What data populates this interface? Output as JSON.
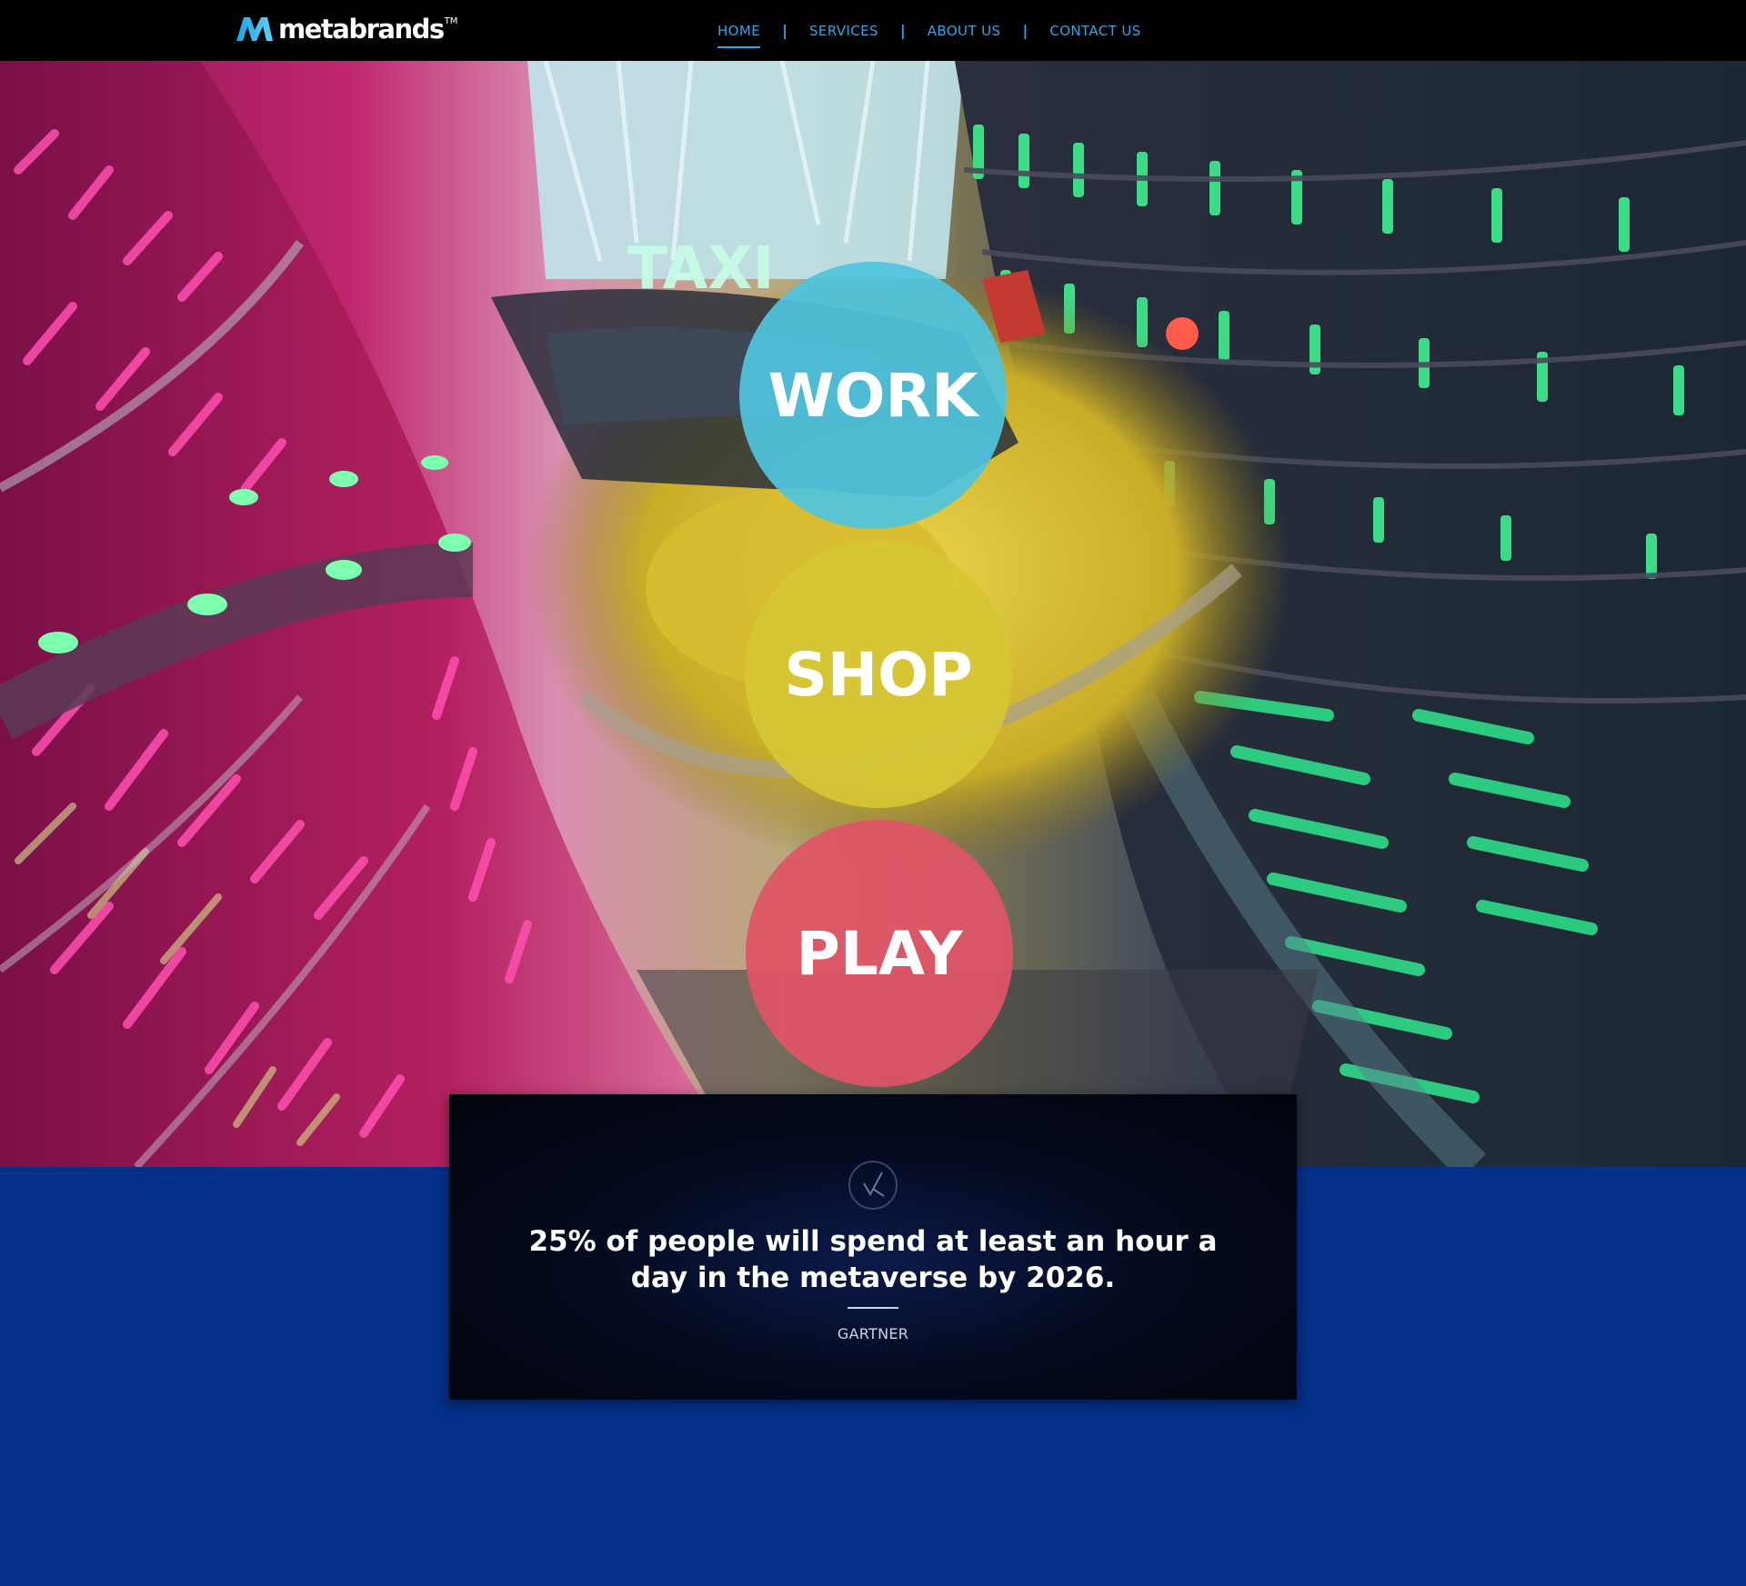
{
  "brand": {
    "name": "metabrands",
    "trademark": "TM"
  },
  "nav": {
    "items": [
      {
        "label": "HOME",
        "active": true
      },
      {
        "label": "SERVICES",
        "active": false
      },
      {
        "label": "ABOUT US",
        "active": false
      },
      {
        "label": "CONTACT US",
        "active": false
      }
    ],
    "separator": "|",
    "color": "#2ea7e8"
  },
  "hero": {
    "circles": [
      {
        "label": "WORK",
        "color": "#50c4de"
      },
      {
        "label": "SHOP",
        "color": "#d6c634"
      },
      {
        "label": "PLAY",
        "color": "#e05467"
      }
    ]
  },
  "quote": {
    "icon": "checkmark-circle-icon",
    "text": "25% of people will spend at least an hour a day in the metaverse by 2026.",
    "source": "GARTNER"
  },
  "colors": {
    "page_background": "#04308a",
    "navbar_background": "#000000"
  }
}
